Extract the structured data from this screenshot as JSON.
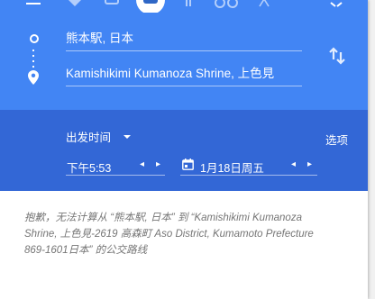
{
  "route": {
    "origin": "熊本駅, 日本",
    "destination": "Kamishikimi Kumanoza Shrine, 上色見"
  },
  "options": {
    "depart_label": "出发时间",
    "options_label": "选项",
    "time": "下午5:53",
    "date": "1月18日周五"
  },
  "message": "抱歉，无法计算从 “熊本駅, 日本” 到 “Kamishikimi Kumanoza Shrine, 上色見-2619 高森町 Aso District, Kumamoto Prefecture 869-1601日本” 的公交路线",
  "colors": {
    "header": "#4285f4",
    "options_bar": "#3367d6",
    "message_text": "#757575"
  },
  "icons": [
    "menu-icon",
    "directions-icon",
    "car-icon",
    "transit-icon",
    "walk-icon",
    "bicycle-icon",
    "flight-icon",
    "close-icon",
    "swap-icon",
    "calendar-icon"
  ]
}
